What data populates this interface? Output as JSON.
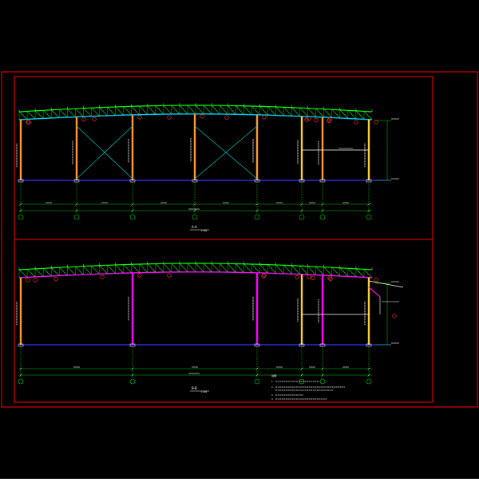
{
  "colors": {
    "background": "#000000",
    "outer_border": "#ff0000",
    "truss": "#00ff00",
    "purlin": "#00c8ff",
    "brace": "#00c8c8",
    "column_orange": "#ff9933",
    "column_magenta": "#ff00ff",
    "column_yellow": "#ffcc33",
    "ground": "#3333ff",
    "dimension": "#00cc00",
    "tag": "#ff3333",
    "text": "#ffffff"
  },
  "elevation_top": {
    "caption": "A-A",
    "scale": "1:100"
  },
  "elevation_bottom": {
    "caption": "B-B",
    "scale": "1:100"
  },
  "notes": {
    "title": "说明:",
    "lines": [
      "1.",
      "2.",
      "3.",
      "4."
    ]
  }
}
